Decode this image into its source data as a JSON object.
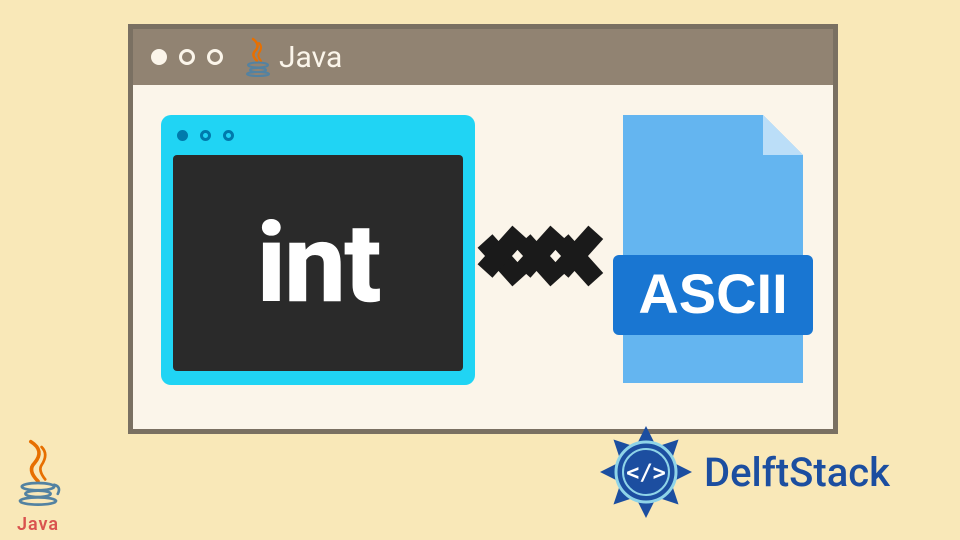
{
  "window": {
    "title": "Java",
    "icon": "java-logo-icon"
  },
  "int_card": {
    "text": "int"
  },
  "arrow": {
    "direction": "right",
    "count": 3
  },
  "file_card": {
    "label": "ASCII",
    "type": "file-icon"
  },
  "brand": {
    "name": "DelftStack",
    "icon": "delftstack-logo-icon"
  },
  "corner": {
    "label": "Java",
    "icon": "java-logo-icon"
  }
}
